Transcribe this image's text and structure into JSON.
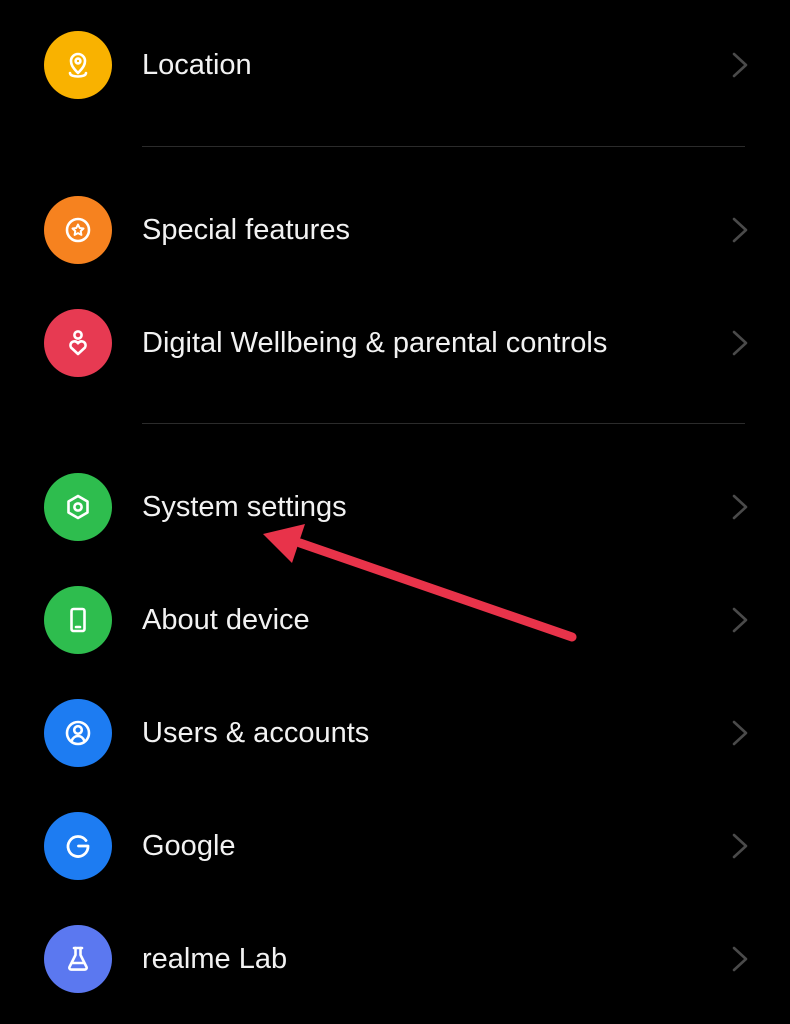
{
  "colors": {
    "background": "#000000",
    "text": "#f2f2f2",
    "chevron": "#4a4a4a",
    "divider": "#2b2b2b",
    "annotation_arrow": "#e8334a"
  },
  "settings": {
    "items": [
      {
        "label": "Location",
        "icon": "location-pin-icon",
        "icon_bg": "#f9b200"
      },
      {
        "label": "Special features",
        "icon": "star-circle-icon",
        "icon_bg": "#f6821f"
      },
      {
        "label": "Digital Wellbeing & parental controls",
        "icon": "person-heart-icon",
        "icon_bg": "#e73a52"
      },
      {
        "label": "System settings",
        "icon": "hexagon-gear-icon",
        "icon_bg": "#2ebd4e"
      },
      {
        "label": "About device",
        "icon": "phone-device-icon",
        "icon_bg": "#2ebd4e"
      },
      {
        "label": "Users & accounts",
        "icon": "user-circle-icon",
        "icon_bg": "#1d7cf2"
      },
      {
        "label": "Google",
        "icon": "google-g-icon",
        "icon_bg": "#1d7cf2"
      },
      {
        "label": "realme Lab",
        "icon": "flask-icon",
        "icon_bg": "#5b78f0"
      }
    ]
  }
}
